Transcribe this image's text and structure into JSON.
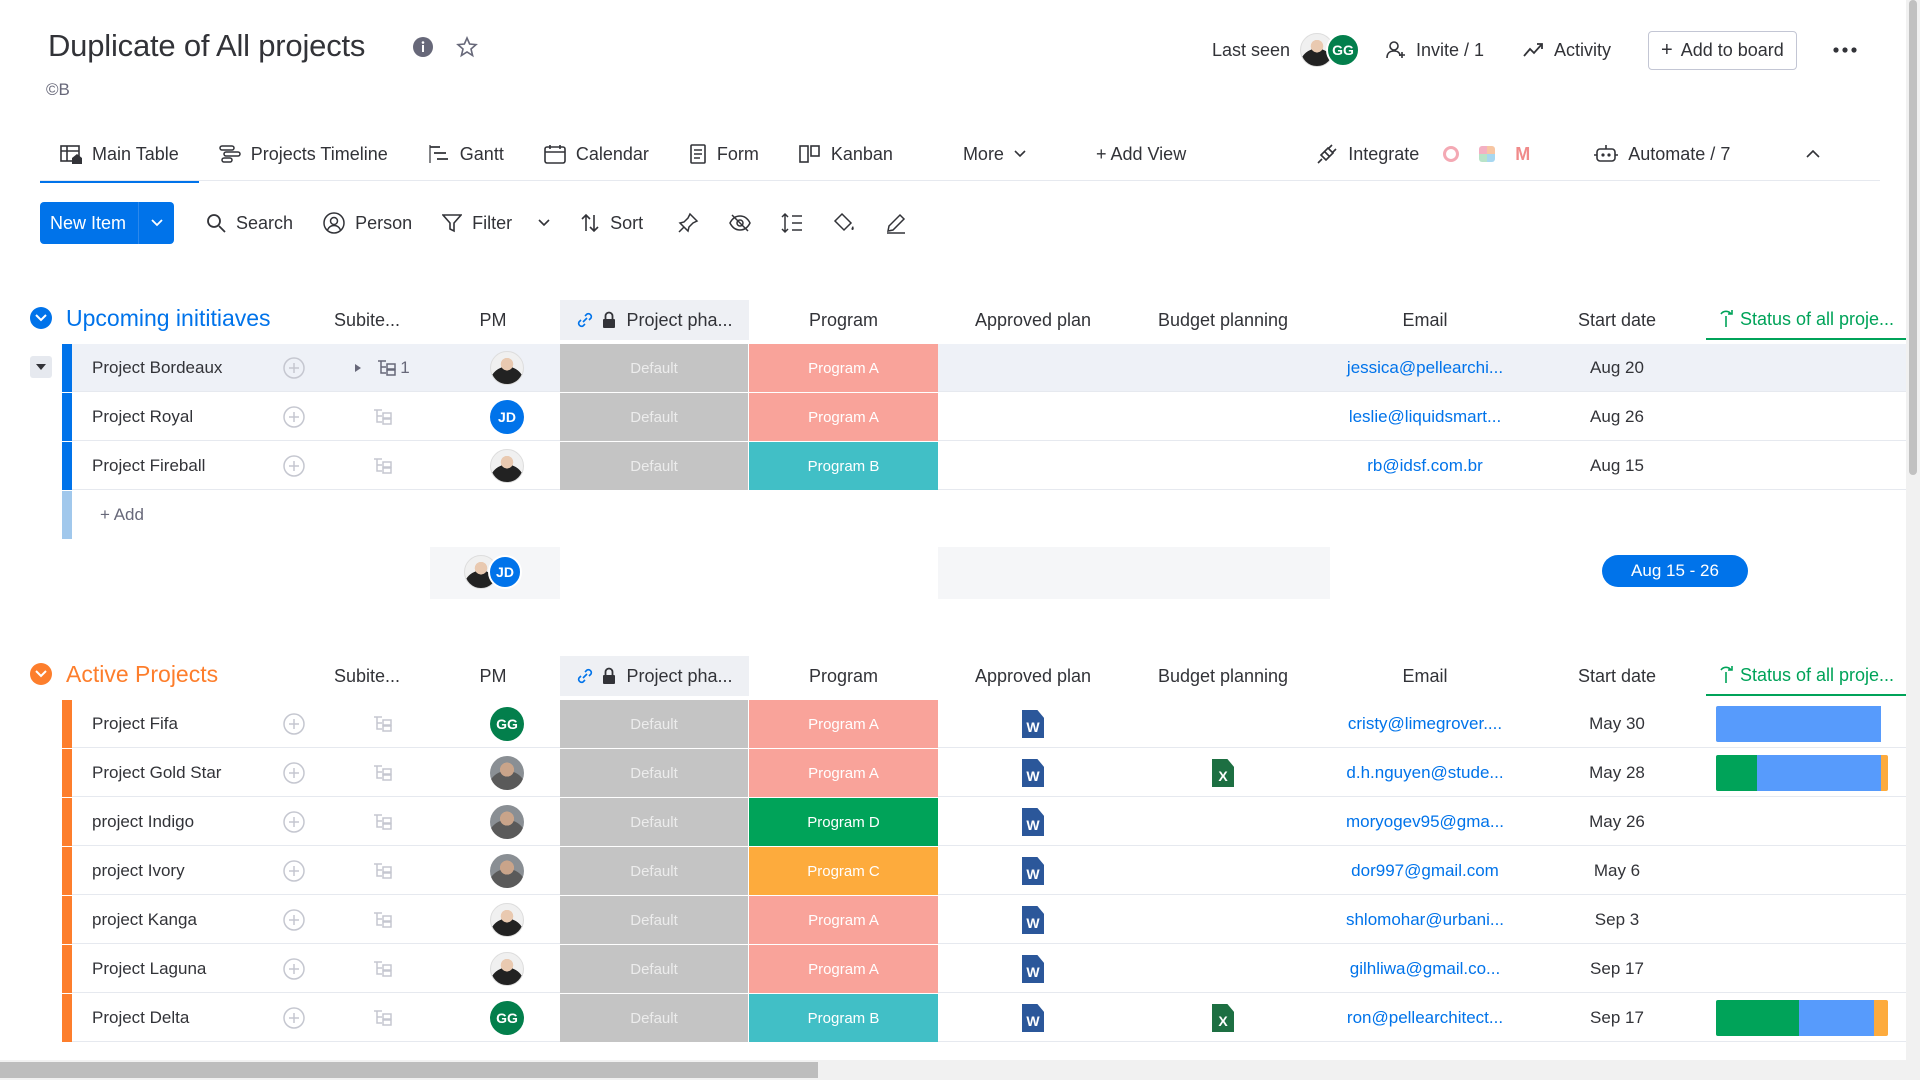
{
  "header": {
    "title": "Duplicate of All projects",
    "subtitle": "©B",
    "last_seen": "Last seen",
    "last_seen_initials": "GG",
    "invite": "Invite / 1",
    "activity": "Activity",
    "add_to_board": "Add to board"
  },
  "tabs": {
    "main_table": "Main Table",
    "projects_timeline": "Projects Timeline",
    "gantt": "Gantt",
    "calendar": "Calendar",
    "form": "Form",
    "kanban": "Kanban",
    "more": "More",
    "add_view": "+ Add View",
    "integrate": "Integrate",
    "automate": "Automate / 7"
  },
  "toolbar": {
    "new_item": "New Item",
    "search": "Search",
    "person": "Person",
    "filter": "Filter",
    "sort": "Sort"
  },
  "columns": {
    "subitems": "Subite...",
    "pm": "PM",
    "phase": "Project pha...",
    "program": "Program",
    "approved": "Approved plan",
    "budget": "Budget planning",
    "email": "Email",
    "start_date": "Start date",
    "status": "Status of all proje..."
  },
  "colors": {
    "blue": "#0073ea",
    "orange": "#fd7e2c",
    "programA": "#f9a39a",
    "programB": "#41bfc6",
    "programC": "#fdab3d",
    "programD": "#00a359",
    "green": "#00a359",
    "statusBlue": "#579bfc",
    "statusOrange": "#fdab3d"
  },
  "groups": [
    {
      "title": "Upcoming inititiaves",
      "rows": [
        {
          "name": "Project Bordeaux",
          "subcount": "1",
          "pm": "photo",
          "phase": "Default",
          "program": "Program A",
          "program_key": "A",
          "email": "jessica@pellearchi...",
          "date": "Aug 20",
          "approved": false,
          "budget": false,
          "status": []
        },
        {
          "name": "Project Royal",
          "subcount": "",
          "pm": "JD",
          "phase": "Default",
          "program": "Program A",
          "program_key": "A",
          "email": "leslie@liquidsmart...",
          "date": "Aug 26",
          "approved": false,
          "budget": false,
          "status": []
        },
        {
          "name": "Project Fireball",
          "subcount": "",
          "pm": "photo",
          "phase": "Default",
          "program": "Program B",
          "program_key": "B",
          "email": "rb@idsf.com.br",
          "date": "Aug 15",
          "approved": false,
          "budget": false,
          "status": []
        }
      ],
      "add_label": "+ Add",
      "summary_initials": "JD",
      "date_range": "Aug 15 - 26"
    },
    {
      "title": "Active Projects",
      "rows": [
        {
          "name": "Project Fifa",
          "subcount": "",
          "pm": "GG",
          "phase": "Default",
          "program": "Program A",
          "program_key": "A",
          "email": "cristy@limegrover....",
          "date": "May 30",
          "approved": true,
          "budget": false,
          "status": [
            {
              "c": "statusBlue",
              "w": 0.96
            }
          ]
        },
        {
          "name": "Project Gold Star",
          "subcount": "",
          "pm": "man",
          "phase": "Default",
          "program": "Program A",
          "program_key": "A",
          "email": "d.h.nguyen@stude...",
          "date": "May 28",
          "approved": true,
          "budget": true,
          "status": [
            {
              "c": "green",
              "w": 0.24
            },
            {
              "c": "statusBlue",
              "w": 0.72
            },
            {
              "c": "statusOrange",
              "w": 0.04
            }
          ]
        },
        {
          "name": "project Indigo",
          "subcount": "",
          "pm": "man",
          "phase": "Default",
          "program": "Program D",
          "program_key": "D",
          "email": "moryogev95@gma...",
          "date": "May 26",
          "approved": true,
          "budget": false,
          "status": []
        },
        {
          "name": "project Ivory",
          "subcount": "",
          "pm": "man",
          "phase": "Default",
          "program": "Program C",
          "program_key": "C",
          "email": "dor997@gmail.com",
          "date": "May 6",
          "approved": true,
          "budget": false,
          "status": []
        },
        {
          "name": "project Kanga",
          "subcount": "",
          "pm": "photo",
          "phase": "Default",
          "program": "Program A",
          "program_key": "A",
          "email": "shlomohar@urbani...",
          "date": "Sep 3",
          "approved": true,
          "budget": false,
          "status": []
        },
        {
          "name": "Project Laguna",
          "subcount": "",
          "pm": "photo",
          "phase": "Default",
          "program": "Program A",
          "program_key": "A",
          "email": "gilhliwa@gmail.co...",
          "date": "Sep 17",
          "approved": true,
          "budget": false,
          "status": []
        },
        {
          "name": "Project Delta",
          "subcount": "",
          "pm": "GG",
          "phase": "Default",
          "program": "Program B",
          "program_key": "B",
          "email": "ron@pellearchitect...",
          "date": "Sep 17",
          "approved": true,
          "budget": true,
          "status": [
            {
              "c": "green",
              "w": 0.48
            },
            {
              "c": "statusBlue",
              "w": 0.44
            },
            {
              "c": "statusOrange",
              "w": 0.08
            }
          ]
        }
      ]
    }
  ]
}
